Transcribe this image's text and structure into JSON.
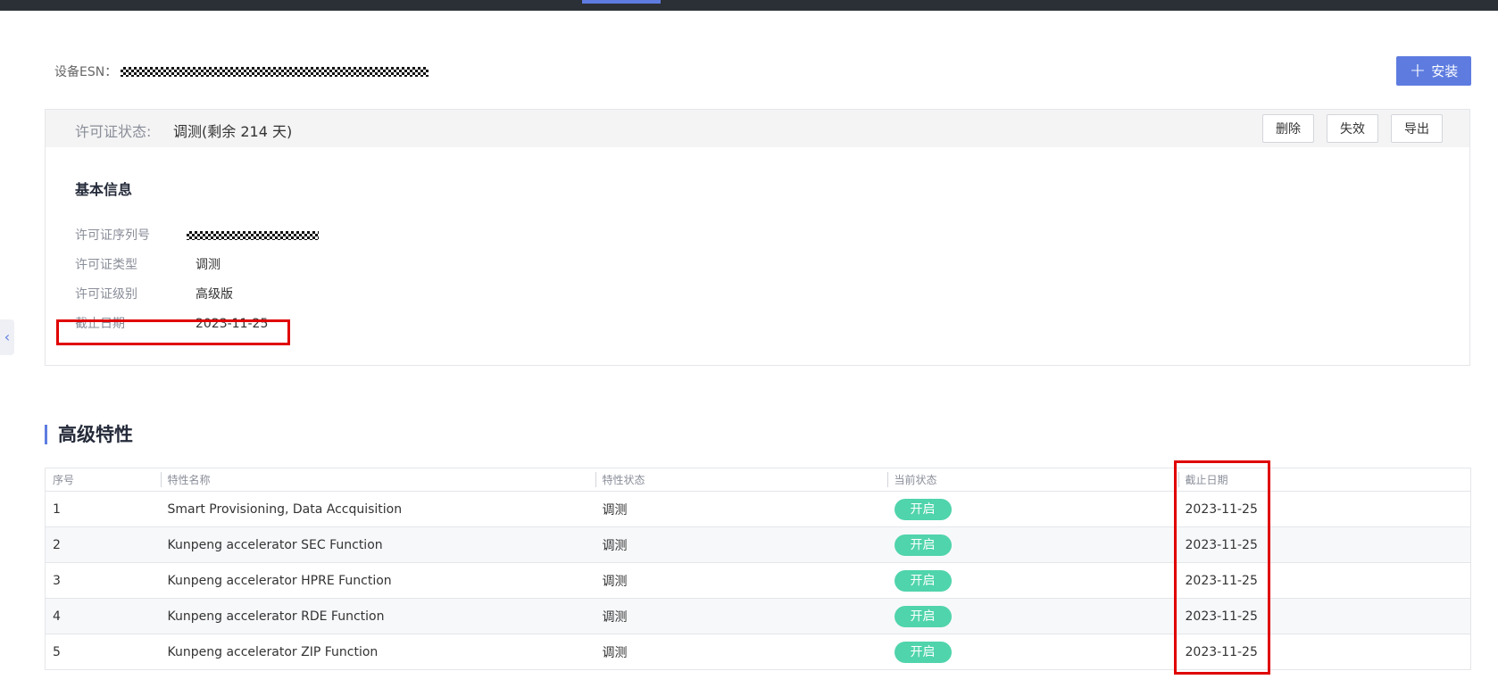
{
  "device": {
    "esn_label": "设备ESN："
  },
  "toolbar": {
    "install_label": "安装"
  },
  "license": {
    "status_label": "许可证状态:",
    "status_value": "调测(剩余 214 天)",
    "actions": {
      "delete_label": "删除",
      "invalidate_label": "失效",
      "export_label": "导出"
    },
    "basic_info_title": "基本信息",
    "serial_label": "许可证序列号",
    "type_label": "许可证类型",
    "type_value": "调测",
    "level_label": "许可证级别",
    "level_value": "高级版",
    "expiry_label": "截止日期",
    "expiry_value": "2023-11-25"
  },
  "features": {
    "title": "高级特性",
    "columns": [
      "序号",
      "特性名称",
      "特性状态",
      "当前状态",
      "截止日期"
    ],
    "rows": [
      {
        "index": "1",
        "name": "Smart Provisioning, Data Accquisition",
        "feature_status": "调测",
        "current_status": "开启",
        "expiry": "2023-11-25"
      },
      {
        "index": "2",
        "name": "Kunpeng accelerator SEC Function",
        "feature_status": "调测",
        "current_status": "开启",
        "expiry": "2023-11-25"
      },
      {
        "index": "3",
        "name": "Kunpeng accelerator HPRE Function",
        "feature_status": "调测",
        "current_status": "开启",
        "expiry": "2023-11-25"
      },
      {
        "index": "4",
        "name": "Kunpeng accelerator RDE Function",
        "feature_status": "调测",
        "current_status": "开启",
        "expiry": "2023-11-25"
      },
      {
        "index": "5",
        "name": "Kunpeng accelerator ZIP Function",
        "feature_status": "调测",
        "current_status": "开启",
        "expiry": "2023-11-25"
      }
    ]
  },
  "colors": {
    "accent": "#5e7ce0",
    "status_on": "#50d4ab",
    "highlight": "#e00000"
  }
}
